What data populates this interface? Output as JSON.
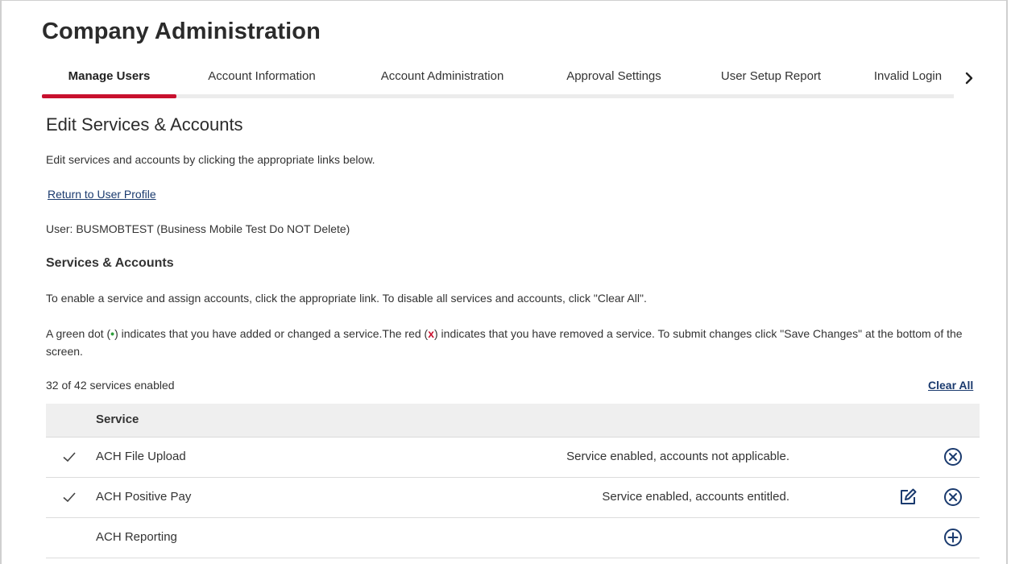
{
  "page": {
    "title": "Company Administration"
  },
  "tabs": [
    {
      "label": "Manage Users",
      "active": true
    },
    {
      "label": "Account Information",
      "active": false
    },
    {
      "label": "Account Administration",
      "active": false
    },
    {
      "label": "Approval Settings",
      "active": false
    },
    {
      "label": "User Setup Report",
      "active": false
    },
    {
      "label": "Invalid Login",
      "active": false
    }
  ],
  "section": {
    "title": "Edit Services & Accounts",
    "intro": "Edit services and accounts by clicking the appropriate links below.",
    "return_link": "Return to User Profile",
    "user_line": "User: BUSMOBTEST (Business Mobile Test Do NOT Delete)",
    "services_heading": "Services & Accounts",
    "instructions": "To enable a service and assign accounts, click the appropriate link. To disable all services and accounts, click \"Clear All\".",
    "legend": {
      "part1": "A green dot (",
      "green_symbol": "•",
      "part2": ") indicates that you have added or changed a service.The red (",
      "red_symbol": "x",
      "part3": ") indicates that you have removed a service. To submit changes click \"Save Changes\" at the bottom of the screen."
    },
    "count_text": "32 of 42 services enabled",
    "clear_all": "Clear All"
  },
  "table": {
    "header": "Service",
    "rows": [
      {
        "service": "ACH File Upload",
        "status": "Service enabled, accounts not applicable.",
        "enabled": true
      },
      {
        "service": "ACH Positive Pay",
        "status": "Service enabled, accounts entitled.",
        "enabled": true
      },
      {
        "service": "ACH Reporting",
        "status": "",
        "enabled": false
      }
    ]
  },
  "colors": {
    "accent": "#c8102e",
    "link": "#1a3a6e",
    "green": "#2e9e3a"
  },
  "icons": [
    "chevron-right-icon",
    "checkmark-icon",
    "edit-icon",
    "remove-circle-icon",
    "add-circle-icon"
  ]
}
